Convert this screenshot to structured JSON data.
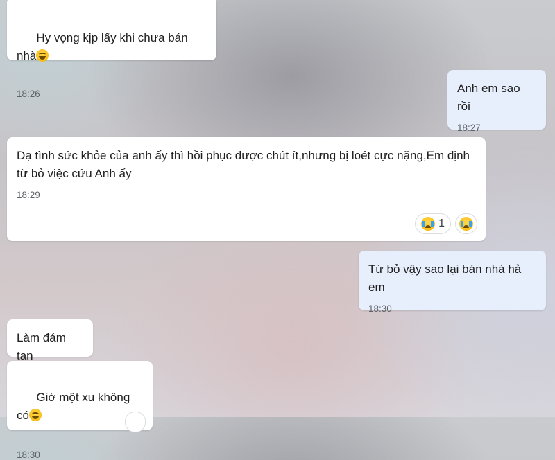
{
  "messages": [
    {
      "direction": "incoming",
      "text": "Hy vọng kịp lấy khi chưa bán nhà",
      "emoji": "grinning-sweat-emoji",
      "time": "18:26"
    },
    {
      "direction": "outgoing",
      "text": "Anh em sao rồi",
      "time": "18:27"
    },
    {
      "direction": "incoming",
      "text": "Dạ tình sức khỏe của anh ấy thì hồi phục được chút ít,nhưng bị loét cực nặng,Em định\ntừ bỏ việc cứu Anh ấy",
      "time": "18:29",
      "reactions": [
        {
          "emoji": "crying-emoji",
          "count": "1"
        }
      ]
    },
    {
      "direction": "outgoing",
      "text": "Từ bỏ vậy sao lại bán nhà hả em",
      "time": "18:30"
    },
    {
      "direction": "incoming",
      "text": "Làm đám tan",
      "time": ""
    },
    {
      "direction": "incoming",
      "text": "Giờ một xu không có",
      "emoji": "grinning-sweat-emoji",
      "time": "18:30"
    }
  ],
  "colors": {
    "incoming_bubble": "#ffffff",
    "outgoing_bubble": "#e8effc",
    "time_text": "#5f6368"
  }
}
